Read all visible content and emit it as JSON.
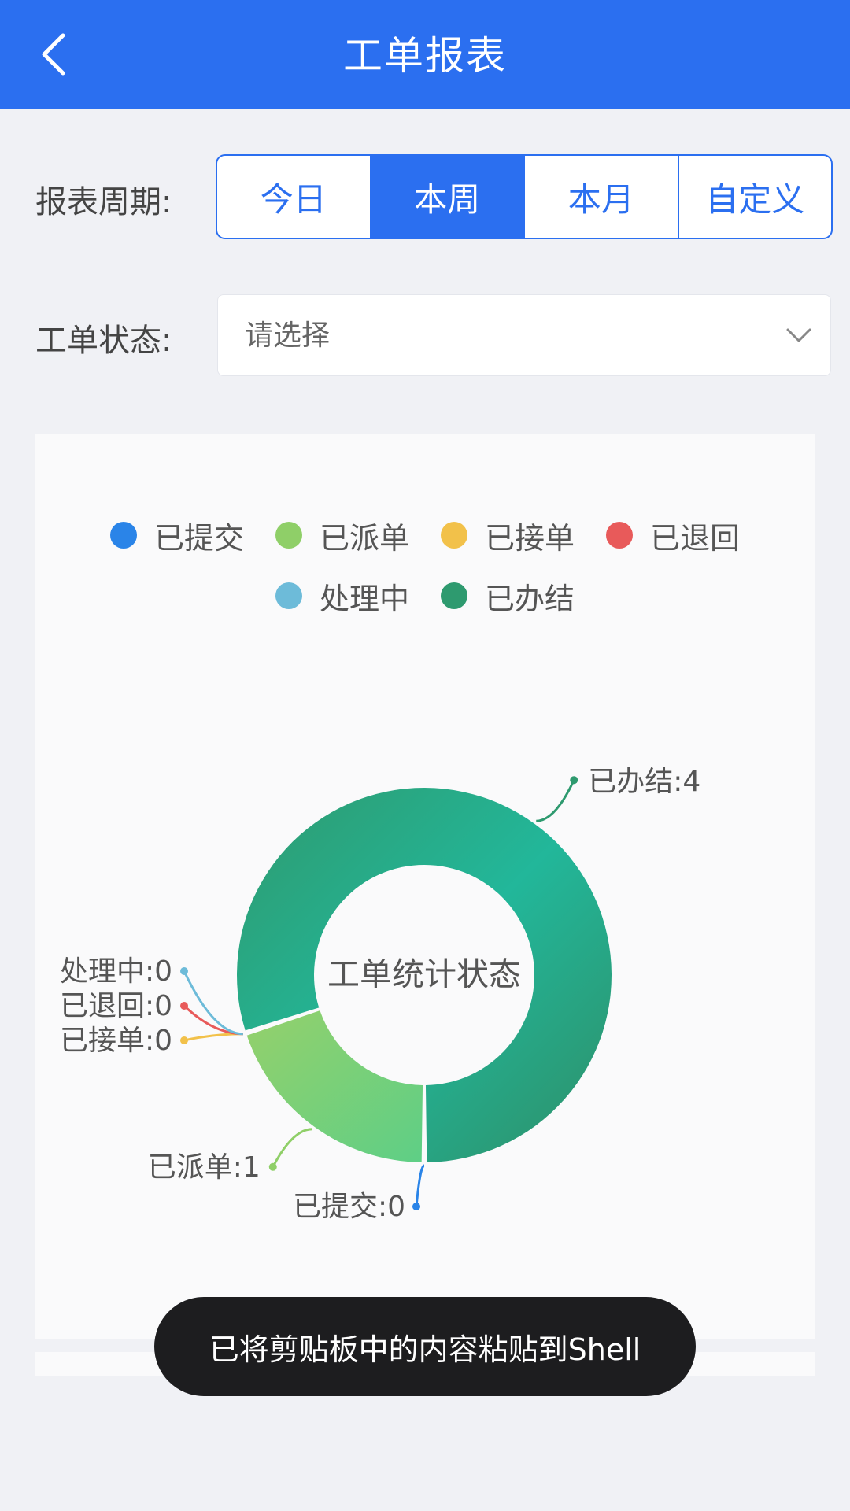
{
  "header": {
    "title": "工单报表",
    "back_icon": "chevron-left-icon"
  },
  "period": {
    "label": "报表周期:",
    "options": [
      "今日",
      "本周",
      "本月",
      "自定义"
    ],
    "selected": "本周"
  },
  "status_filter": {
    "label": "工单状态:",
    "placeholder": "请选择",
    "arrow_icon": "chevron-down-icon"
  },
  "chart_data": {
    "type": "pie",
    "variant": "donut",
    "title": "工单统计状态",
    "legend_position": "top",
    "categories": [
      "已提交",
      "已派单",
      "已接单",
      "已退回",
      "处理中",
      "已办结"
    ],
    "values": [
      0,
      1,
      0,
      0,
      0,
      4
    ],
    "colors": [
      "#2a84e8",
      "#8fcf68",
      "#f2c14a",
      "#e85a5a",
      "#6dbbd9",
      "#2e9a6f"
    ],
    "data_labels": [
      "已提交:0",
      "已派单:1",
      "已接单:0",
      "已退回:0",
      "处理中:0",
      "已办结:4"
    ]
  },
  "toast": {
    "message": "已将剪贴板中的内容粘贴到Shell"
  }
}
